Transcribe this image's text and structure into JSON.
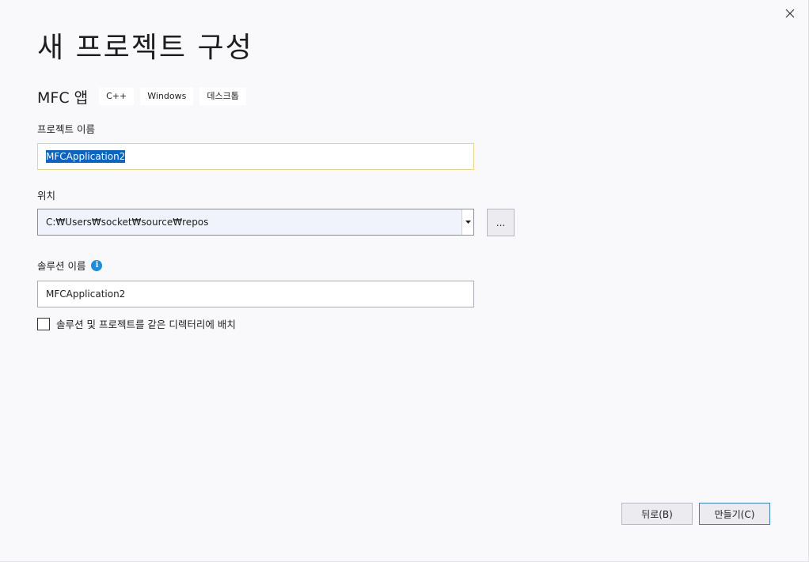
{
  "dialog": {
    "title": "새 프로젝트 구성",
    "close_icon": "close-icon"
  },
  "template": {
    "name": "MFC 앱",
    "tags": [
      "C++",
      "Windows",
      "데스크톱"
    ]
  },
  "project_name": {
    "label": "프로젝트 이름",
    "value": "MFCApplication2"
  },
  "location": {
    "label": "위치",
    "value": "C:₩Users₩socket₩source₩repos",
    "browse_label": "..."
  },
  "solution_name": {
    "label": "솔루션 이름",
    "info_icon": "info-icon",
    "value": "MFCApplication2"
  },
  "same_directory": {
    "label": "솔루션 및 프로젝트를 같은 디렉터리에 배치",
    "checked": false
  },
  "buttons": {
    "back_label": "뒤로(B)",
    "create_label": "만들기(C)"
  },
  "colors": {
    "accent": "#0a64c8",
    "info": "#1b8ce0",
    "focus_border": "#e8d58a",
    "primary_button_border": "#3c7fd1"
  }
}
